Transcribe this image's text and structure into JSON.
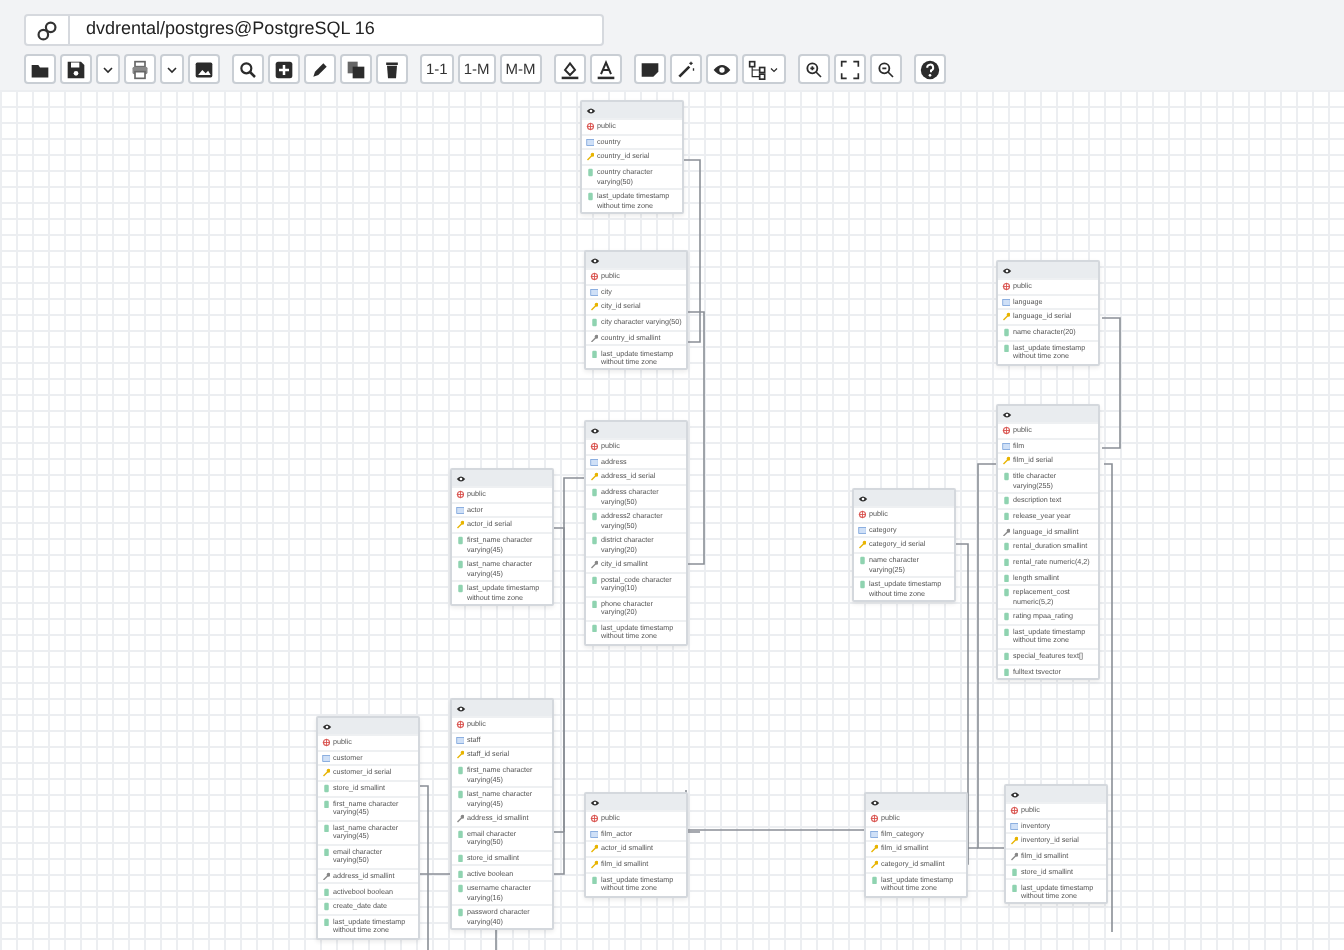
{
  "connection": {
    "title": "dvdrental/postgres@PostgreSQL 16"
  },
  "relation_buttons": [
    "1-1",
    "1-M",
    "M-M"
  ],
  "tables": [
    {
      "schema": "public",
      "name": "country",
      "columns": [
        {
          "text": "country_id serial",
          "kind": "pk"
        },
        {
          "text": "country character varying(50)",
          "kind": "col"
        },
        {
          "text": "last_update timestamp without time zone",
          "kind": "col"
        }
      ]
    },
    {
      "schema": "public",
      "name": "city",
      "columns": [
        {
          "text": "city_id serial",
          "kind": "pk"
        },
        {
          "text": "city character varying(50)",
          "kind": "col"
        },
        {
          "text": "country_id smallint",
          "kind": "fk"
        },
        {
          "text": "last_update timestamp without time zone",
          "kind": "col"
        }
      ]
    },
    {
      "schema": "public",
      "name": "language",
      "columns": [
        {
          "text": "language_id serial",
          "kind": "pk"
        },
        {
          "text": "name character(20)",
          "kind": "col"
        },
        {
          "text": "last_update timestamp without time zone",
          "kind": "col"
        }
      ]
    },
    {
      "schema": "public",
      "name": "actor",
      "columns": [
        {
          "text": "actor_id serial",
          "kind": "pk"
        },
        {
          "text": "first_name character varying(45)",
          "kind": "col"
        },
        {
          "text": "last_name character varying(45)",
          "kind": "col"
        },
        {
          "text": "last_update timestamp without time zone",
          "kind": "col"
        }
      ]
    },
    {
      "schema": "public",
      "name": "address",
      "columns": [
        {
          "text": "address_id serial",
          "kind": "pk"
        },
        {
          "text": "address character varying(50)",
          "kind": "col"
        },
        {
          "text": "address2 character varying(50)",
          "kind": "col"
        },
        {
          "text": "district character varying(20)",
          "kind": "col"
        },
        {
          "text": "city_id smallint",
          "kind": "fk"
        },
        {
          "text": "postal_code character varying(10)",
          "kind": "col"
        },
        {
          "text": "phone character varying(20)",
          "kind": "col"
        },
        {
          "text": "last_update timestamp without time zone",
          "kind": "col"
        }
      ]
    },
    {
      "schema": "public",
      "name": "category",
      "columns": [
        {
          "text": "category_id serial",
          "kind": "pk"
        },
        {
          "text": "name character varying(25)",
          "kind": "col"
        },
        {
          "text": "last_update timestamp without time zone",
          "kind": "col"
        }
      ]
    },
    {
      "schema": "public",
      "name": "film",
      "columns": [
        {
          "text": "film_id serial",
          "kind": "pk"
        },
        {
          "text": "title character varying(255)",
          "kind": "col"
        },
        {
          "text": "description text",
          "kind": "col"
        },
        {
          "text": "release_year year",
          "kind": "col"
        },
        {
          "text": "language_id smallint",
          "kind": "fk"
        },
        {
          "text": "rental_duration smallint",
          "kind": "col"
        },
        {
          "text": "rental_rate numeric(4,2)",
          "kind": "col"
        },
        {
          "text": "length smallint",
          "kind": "col"
        },
        {
          "text": "replacement_cost numeric(5,2)",
          "kind": "col"
        },
        {
          "text": "rating mpaa_rating",
          "kind": "col"
        },
        {
          "text": "last_update timestamp without time zone",
          "kind": "col"
        },
        {
          "text": "special_features text[]",
          "kind": "col"
        },
        {
          "text": "fulltext tsvector",
          "kind": "col"
        }
      ]
    },
    {
      "schema": "public",
      "name": "customer",
      "columns": [
        {
          "text": "customer_id serial",
          "kind": "pk"
        },
        {
          "text": "store_id smallint",
          "kind": "col"
        },
        {
          "text": "first_name character varying(45)",
          "kind": "col"
        },
        {
          "text": "last_name character varying(45)",
          "kind": "col"
        },
        {
          "text": "email character varying(50)",
          "kind": "col"
        },
        {
          "text": "address_id smallint",
          "kind": "fk"
        },
        {
          "text": "activebool boolean",
          "kind": "col"
        },
        {
          "text": "create_date date",
          "kind": "col"
        },
        {
          "text": "last_update timestamp without time zone",
          "kind": "col"
        }
      ]
    },
    {
      "schema": "public",
      "name": "staff",
      "columns": [
        {
          "text": "staff_id serial",
          "kind": "pk"
        },
        {
          "text": "first_name character varying(45)",
          "kind": "col"
        },
        {
          "text": "last_name character varying(45)",
          "kind": "col"
        },
        {
          "text": "address_id smallint",
          "kind": "fk"
        },
        {
          "text": "email character varying(50)",
          "kind": "col"
        },
        {
          "text": "store_id smallint",
          "kind": "col"
        },
        {
          "text": "active boolean",
          "kind": "col"
        },
        {
          "text": "username character varying(16)",
          "kind": "col"
        },
        {
          "text": "password character varying(40)",
          "kind": "col"
        }
      ]
    },
    {
      "schema": "public",
      "name": "film_actor",
      "columns": [
        {
          "text": "actor_id smallint",
          "kind": "pk"
        },
        {
          "text": "film_id smallint",
          "kind": "pk"
        },
        {
          "text": "last_update timestamp without time zone",
          "kind": "col"
        }
      ]
    },
    {
      "schema": "public",
      "name": "film_category",
      "columns": [
        {
          "text": "film_id smallint",
          "kind": "pk"
        },
        {
          "text": "category_id smallint",
          "kind": "pk"
        },
        {
          "text": "last_update timestamp without time zone",
          "kind": "col"
        }
      ]
    },
    {
      "schema": "public",
      "name": "inventory",
      "columns": [
        {
          "text": "inventory_id serial",
          "kind": "pk"
        },
        {
          "text": "film_id smallint",
          "kind": "fk"
        },
        {
          "text": "store_id smallint",
          "kind": "col"
        },
        {
          "text": "last_update timestamp without time zone",
          "kind": "col"
        }
      ]
    }
  ]
}
